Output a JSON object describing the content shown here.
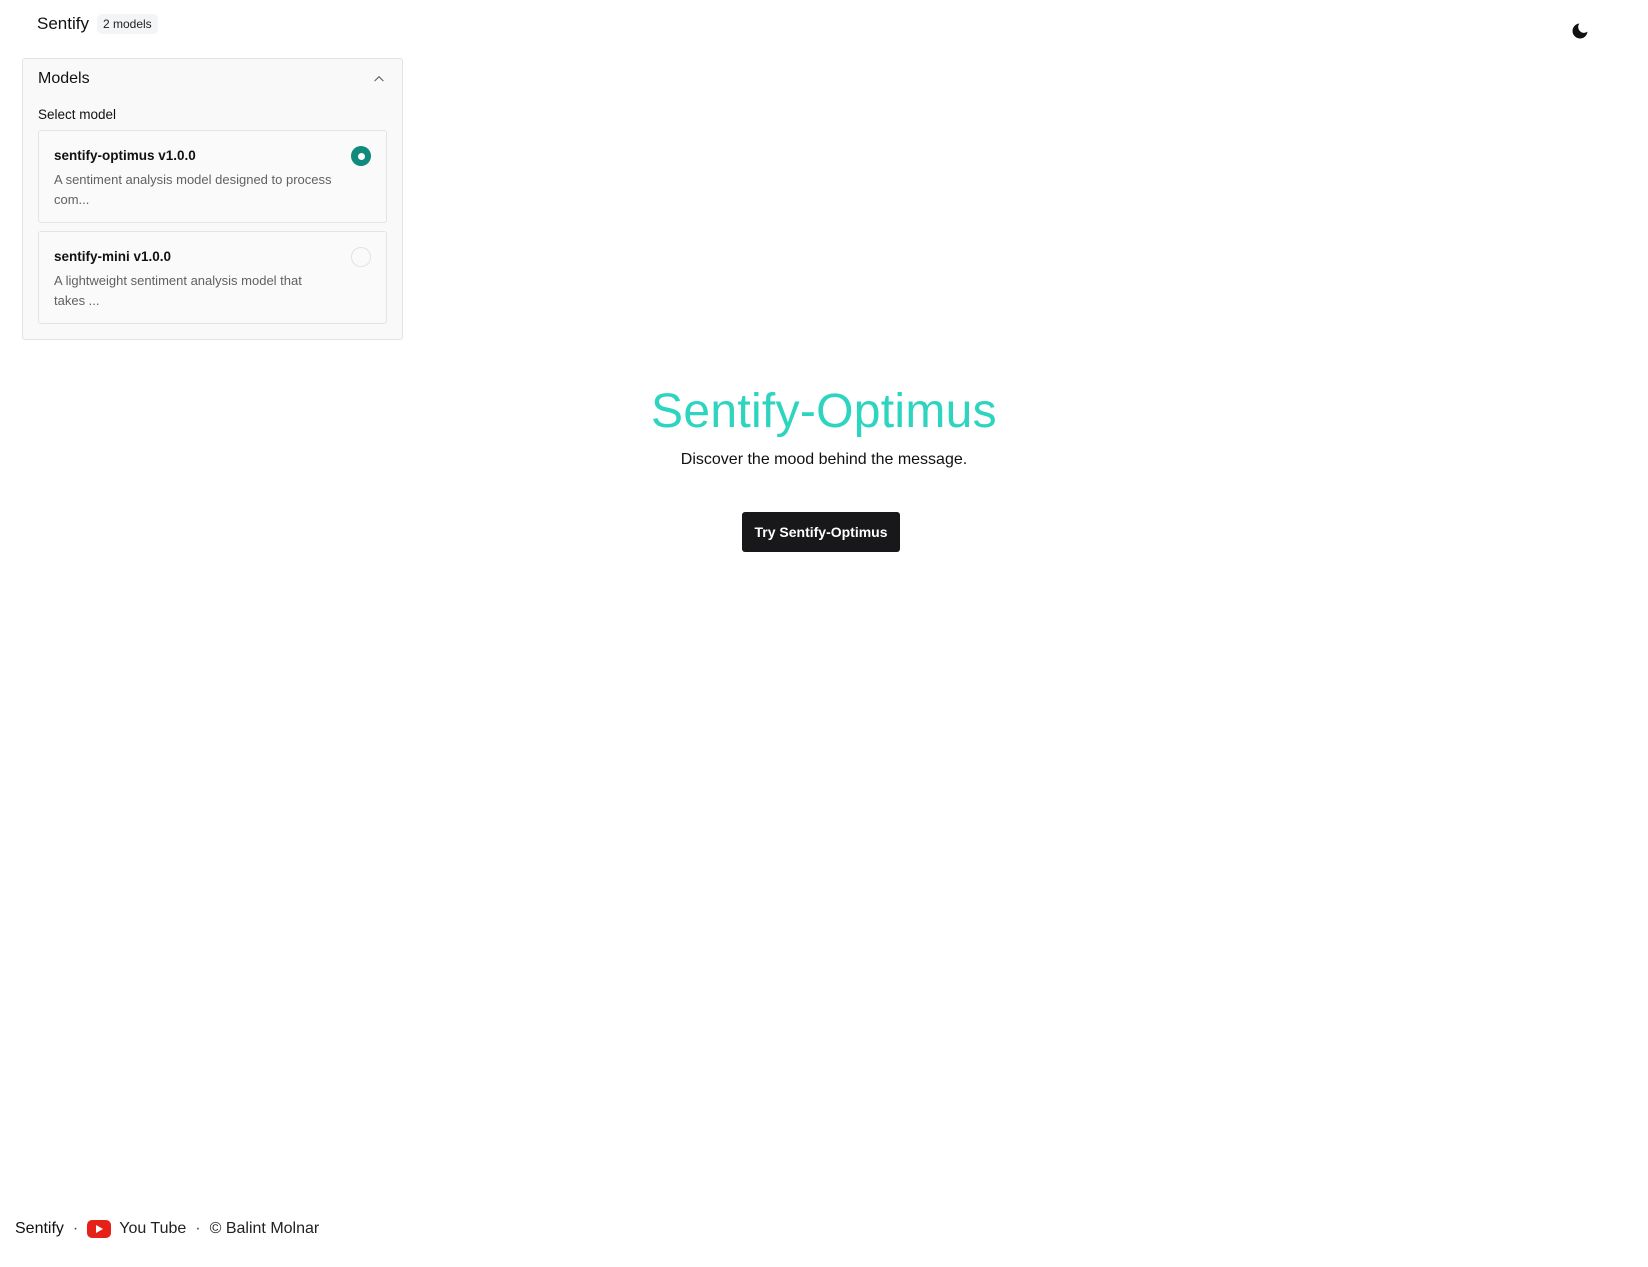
{
  "header": {
    "brand": "Sentify",
    "model_count_badge": "2 models",
    "theme_toggle_icon": "moon-icon"
  },
  "models_panel": {
    "title": "Models",
    "collapse_icon": "chevron-up-icon",
    "select_label": "Select model",
    "models": [
      {
        "name": "sentify-optimus v1.0.0",
        "description": "A sentiment analysis model designed to process com...",
        "selected": true
      },
      {
        "name": "sentify-mini v1.0.0",
        "description": "A lightweight sentiment analysis model that takes ...",
        "selected": false
      }
    ]
  },
  "hero": {
    "title": "Sentify-Optimus",
    "subtitle": "Discover the mood behind the message.",
    "cta_label": "Try Sentify-Optimus"
  },
  "footer": {
    "brand": "Sentify",
    "separator": "·",
    "youtube_icon": "youtube-icon",
    "youtube_label": "You Tube",
    "copyright": "© Balint Molnar"
  },
  "colors": {
    "accent": "#2dd4bf",
    "radio_selected": "#0f8a7c",
    "cta_background": "#18181b",
    "youtube_red": "#e62117"
  }
}
